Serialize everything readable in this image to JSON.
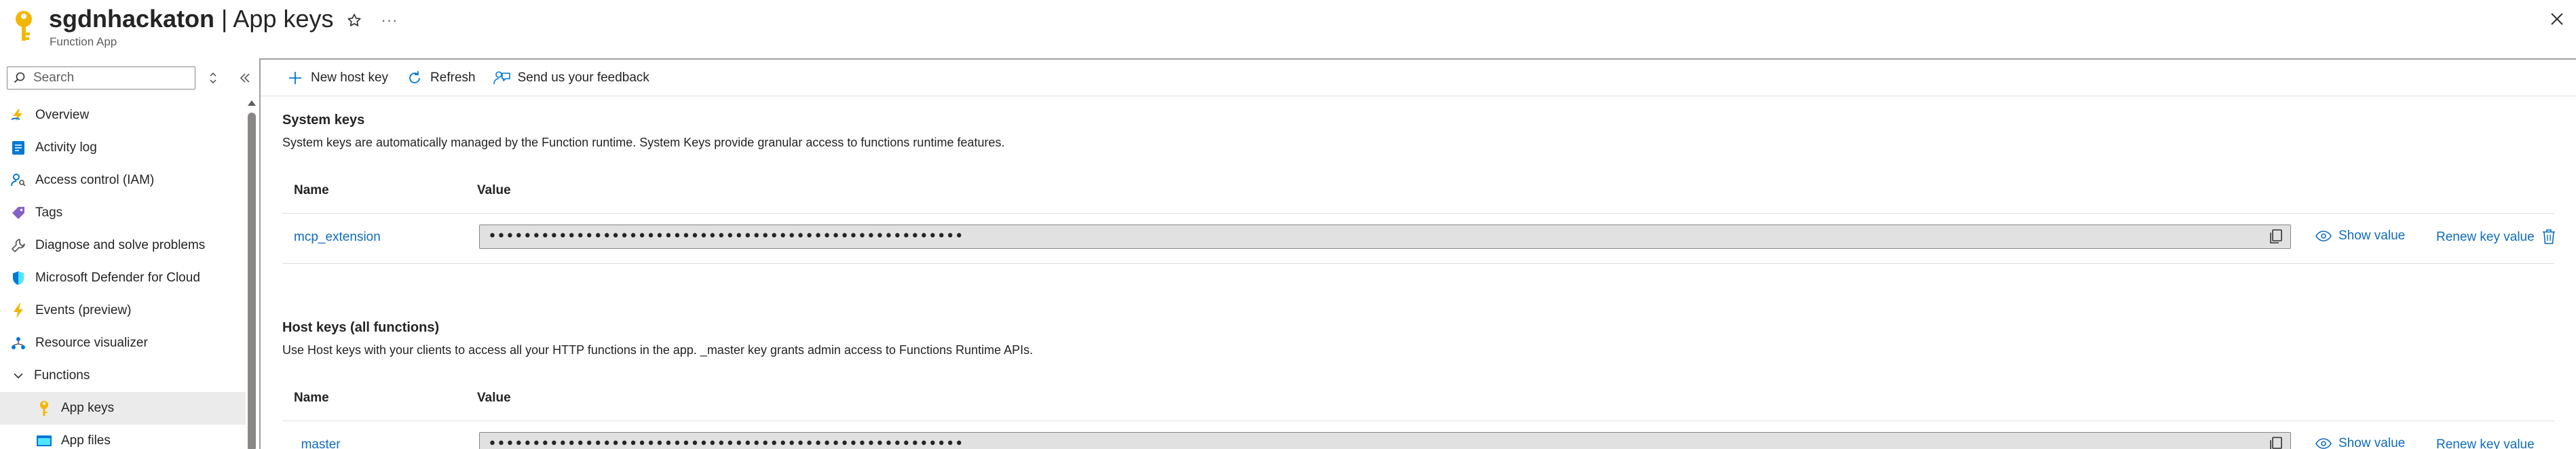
{
  "header": {
    "resource_name": "sgdnhackaton",
    "separator": " | ",
    "page_name": "App keys",
    "resource_type": "Function App",
    "more_label": "···"
  },
  "sidebar": {
    "search_placeholder": "Search",
    "items": [
      {
        "label": "Overview",
        "icon": "overview-icon"
      },
      {
        "label": "Activity log",
        "icon": "activity-log-icon"
      },
      {
        "label": "Access control (IAM)",
        "icon": "iam-icon"
      },
      {
        "label": "Tags",
        "icon": "tag-icon"
      },
      {
        "label": "Diagnose and solve problems",
        "icon": "wrench-icon"
      },
      {
        "label": "Microsoft Defender for Cloud",
        "icon": "shield-icon"
      },
      {
        "label": "Events (preview)",
        "icon": "lightning-icon"
      },
      {
        "label": "Resource visualizer",
        "icon": "hierarchy-icon"
      },
      {
        "label": "Functions",
        "icon": "chevron-down-icon"
      },
      {
        "label": "App keys",
        "icon": "key-icon",
        "selected": true
      },
      {
        "label": "App files",
        "icon": "app-files-icon"
      }
    ]
  },
  "toolbar": {
    "new_host_key": "New host key",
    "refresh": "Refresh",
    "feedback": "Send us your feedback"
  },
  "system_keys": {
    "title": "System keys",
    "description": "System keys are automatically managed by the Function runtime. System Keys provide granular access to functions runtime features.",
    "col_name": "Name",
    "col_value": "Value",
    "rows": [
      {
        "name": "mcp_extension",
        "value": "••••••••••••••••••••••••••••••••••••••••••••••••••••••",
        "show_label": "Show value",
        "renew_label": "Renew key value"
      }
    ]
  },
  "host_keys": {
    "title": "Host keys (all functions)",
    "description": "Use Host keys with your clients to access all your HTTP functions in the app. _master key grants admin access to Functions Runtime APIs.",
    "col_name": "Name",
    "col_value": "Value",
    "rows": [
      {
        "name": "_master",
        "value": "••••••••••••••••••••••••••••••••••••••••••••••••••••••",
        "show_label": "Show value",
        "renew_label": "Renew key value"
      }
    ]
  },
  "colors": {
    "link": "#0f6cbd",
    "key_icon": "#fcd116",
    "selected_bg": "#ebebeb"
  }
}
